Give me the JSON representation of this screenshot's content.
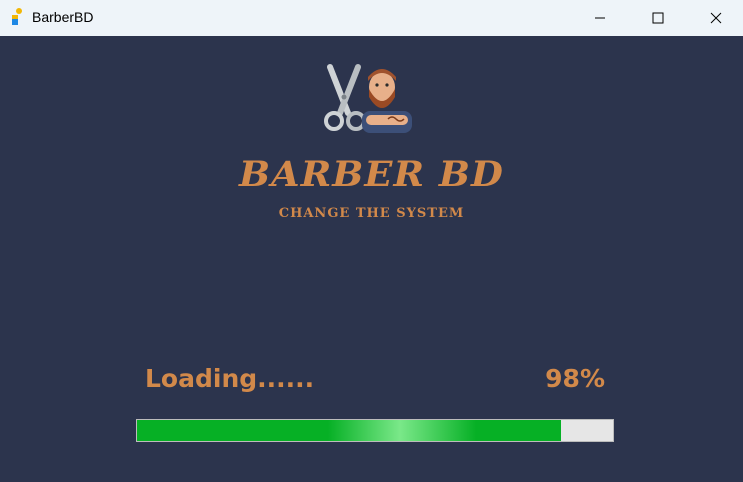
{
  "window": {
    "title": "BarberBD",
    "controls": {
      "minimize": "minimize-icon",
      "maximize": "maximize-icon",
      "close": "close-icon"
    }
  },
  "splash": {
    "logo_icon": "barber-scissors-logo-icon",
    "brand": "BARBER BD",
    "tagline": "CHANGE THE SYSTEM",
    "loading_label": "Loading......",
    "percent_label": "98%",
    "progress_fraction": 0.89
  },
  "colors": {
    "background": "#2c344d",
    "accent": "#d2894a",
    "progress_green": "#06b025",
    "titlebar": "#eef4f9"
  }
}
